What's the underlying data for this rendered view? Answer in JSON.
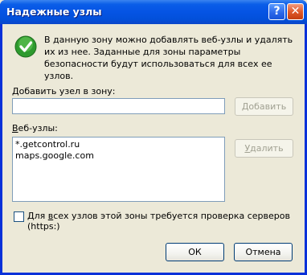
{
  "window": {
    "title": "Надежные узлы",
    "help_glyph": "?",
    "close_glyph": "✕"
  },
  "intro": {
    "text": "В данную зону можно добавлять веб-узлы и удалять их из нее. Заданные для зоны параметры безопасности будут использоваться для всех ее узлов."
  },
  "add": {
    "label_pre": "",
    "label_key": "Д",
    "label_post": "обавить узел  в зону:",
    "value": "",
    "button_pre": "",
    "button_key": "Д",
    "button_post": "обавить"
  },
  "sites": {
    "label_pre": "",
    "label_key": "В",
    "label_post": "еб-узлы:",
    "items": [
      "*.getcontrol.ru",
      "maps.google.com"
    ],
    "remove_pre": "",
    "remove_key": "У",
    "remove_post": "далить"
  },
  "verify": {
    "label_pre": "Для ",
    "label_key": "в",
    "label_post": "сех узлов этой зоны требуется проверка серверов (https:)",
    "checked": false
  },
  "footer": {
    "ok": "ОК",
    "cancel": "Отмена"
  },
  "colors": {
    "accent": "#0831d9",
    "check_green": "#2e9a2e"
  }
}
